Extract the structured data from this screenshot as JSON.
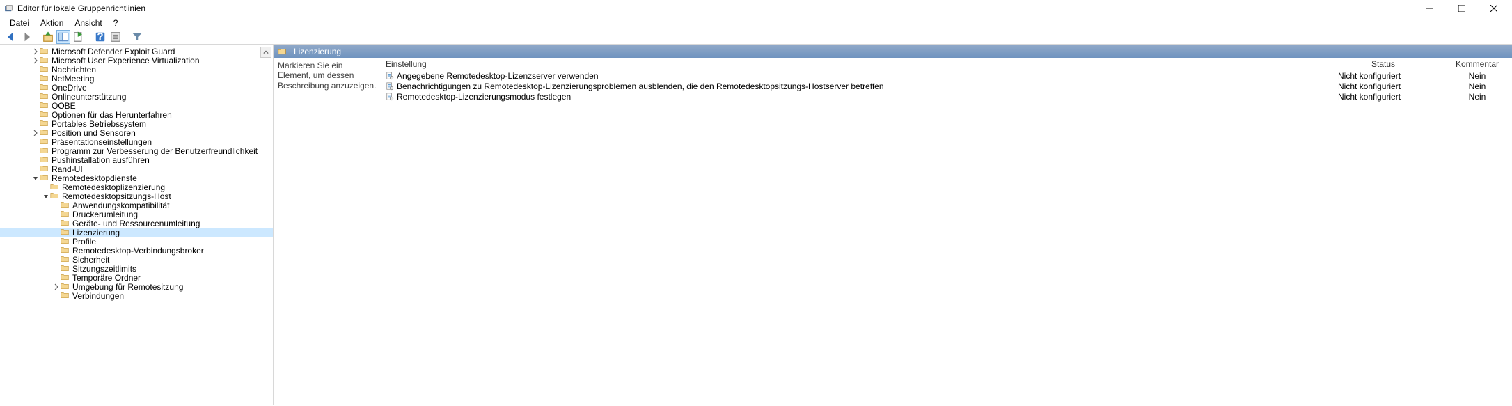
{
  "window": {
    "title": "Editor für lokale Gruppenrichtlinien"
  },
  "menu": {
    "file": "Datei",
    "action": "Aktion",
    "view": "Ansicht",
    "help": "?"
  },
  "tree": {
    "items": [
      {
        "indent": 3,
        "exp": "col",
        "label": "Microsoft Defender Exploit Guard"
      },
      {
        "indent": 3,
        "exp": "col",
        "label": "Microsoft User Experience Virtualization"
      },
      {
        "indent": 3,
        "exp": "none",
        "label": "Nachrichten"
      },
      {
        "indent": 3,
        "exp": "none",
        "label": "NetMeeting"
      },
      {
        "indent": 3,
        "exp": "none",
        "label": "OneDrive"
      },
      {
        "indent": 3,
        "exp": "none",
        "label": "Onlineunterstützung"
      },
      {
        "indent": 3,
        "exp": "none",
        "label": "OOBE"
      },
      {
        "indent": 3,
        "exp": "none",
        "label": "Optionen für das Herunterfahren"
      },
      {
        "indent": 3,
        "exp": "none",
        "label": "Portables Betriebssystem"
      },
      {
        "indent": 3,
        "exp": "col",
        "label": "Position und Sensoren"
      },
      {
        "indent": 3,
        "exp": "none",
        "label": "Präsentationseinstellungen"
      },
      {
        "indent": 3,
        "exp": "none",
        "label": "Programm zur Verbesserung der Benutzerfreundlichkeit"
      },
      {
        "indent": 3,
        "exp": "none",
        "label": "Pushinstallation ausführen"
      },
      {
        "indent": 3,
        "exp": "none",
        "label": "Rand-UI"
      },
      {
        "indent": 3,
        "exp": "exp",
        "label": "Remotedesktopdienste"
      },
      {
        "indent": 4,
        "exp": "none",
        "label": "Remotedesktoplizenzierung"
      },
      {
        "indent": 4,
        "exp": "exp",
        "label": "Remotedesktopsitzungs-Host"
      },
      {
        "indent": 5,
        "exp": "none",
        "label": "Anwendungskompatibilität"
      },
      {
        "indent": 5,
        "exp": "none",
        "label": "Druckerumleitung"
      },
      {
        "indent": 5,
        "exp": "none",
        "label": "Geräte- und Ressourcenumleitung"
      },
      {
        "indent": 5,
        "exp": "none",
        "label": "Lizenzierung",
        "selected": true
      },
      {
        "indent": 5,
        "exp": "none",
        "label": "Profile"
      },
      {
        "indent": 5,
        "exp": "none",
        "label": "Remotedesktop-Verbindungsbroker"
      },
      {
        "indent": 5,
        "exp": "none",
        "label": "Sicherheit"
      },
      {
        "indent": 5,
        "exp": "none",
        "label": "Sitzungszeitlimits"
      },
      {
        "indent": 5,
        "exp": "none",
        "label": "Temporäre Ordner"
      },
      {
        "indent": 5,
        "exp": "col",
        "label": "Umgebung für Remotesitzung"
      },
      {
        "indent": 5,
        "exp": "none",
        "label": "Verbindungen"
      }
    ]
  },
  "right": {
    "header": "Lizenzierung",
    "description": "Markieren Sie ein Element, um dessen Beschreibung anzuzeigen.",
    "columns": {
      "setting": "Einstellung",
      "status": "Status",
      "comment": "Kommentar"
    },
    "rows": [
      {
        "setting": "Angegebene Remotedesktop-Lizenzserver verwenden",
        "status": "Nicht konfiguriert",
        "comment": "Nein"
      },
      {
        "setting": "Benachrichtigungen zu Remotedesktop-Lizenzierungsproblemen ausblenden, die den Remotedesktopsitzungs-Hostserver betreffen",
        "status": "Nicht konfiguriert",
        "comment": "Nein"
      },
      {
        "setting": "Remotedesktop-Lizenzierungsmodus festlegen",
        "status": "Nicht konfiguriert",
        "comment": "Nein"
      }
    ]
  }
}
